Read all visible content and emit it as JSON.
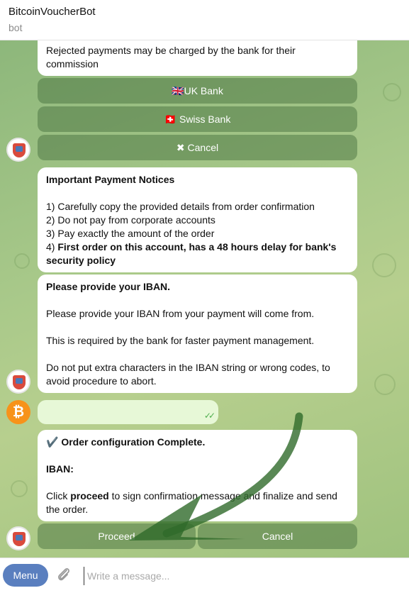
{
  "header": {
    "title": "BitcoinVoucherBot",
    "subtitle": "bot"
  },
  "messages": {
    "top_fragment": "Rejected payments may be charged by the bank for their commission",
    "bank_buttons": [
      "🇬🇧UK Bank",
      "🇨🇭 Swiss Bank"
    ],
    "cancel_button": "✖  Cancel",
    "notices": {
      "title": "Important Payment Notices",
      "items": [
        "1) Carefully copy the provided details from order confirmation",
        "2) Do not pay from corporate accounts",
        "3) Pay exactly the amount of the order"
      ],
      "item4_prefix": "4) ",
      "item4_bold": "First order on this account, has a 48 hours delay for bank's security policy"
    },
    "iban_request": {
      "title": "Please provide your IBAN.",
      "line1": "Please provide your IBAN from your payment will come from.",
      "line2": "This is required by the bank for faster payment management.",
      "line3": "Do not put extra characters in the IBAN string or wrong codes, to avoid procedure to abort."
    },
    "user_reply": {
      "ticks": "✓✓"
    },
    "confirmation": {
      "title": "✔️ Order configuration Complete.",
      "iban_label": "IBAN:",
      "click_prefix": "Click ",
      "click_bold": "proceed",
      "click_suffix": " to sign confirmation message and finalize and send the order."
    },
    "action_buttons": {
      "proceed": "Proceed",
      "cancel": "Cancel"
    }
  },
  "composer": {
    "menu_label": "Menu",
    "placeholder": "Write a message..."
  },
  "colors": {
    "accent": "#5a7fbf",
    "bitcoin": "#f7931a",
    "arrow": "#2f6a2a"
  },
  "icons": [
    "bot-avatar-icon",
    "bitcoin-avatar-icon",
    "attach-icon",
    "double-check-icon",
    "arrow-annotation"
  ]
}
